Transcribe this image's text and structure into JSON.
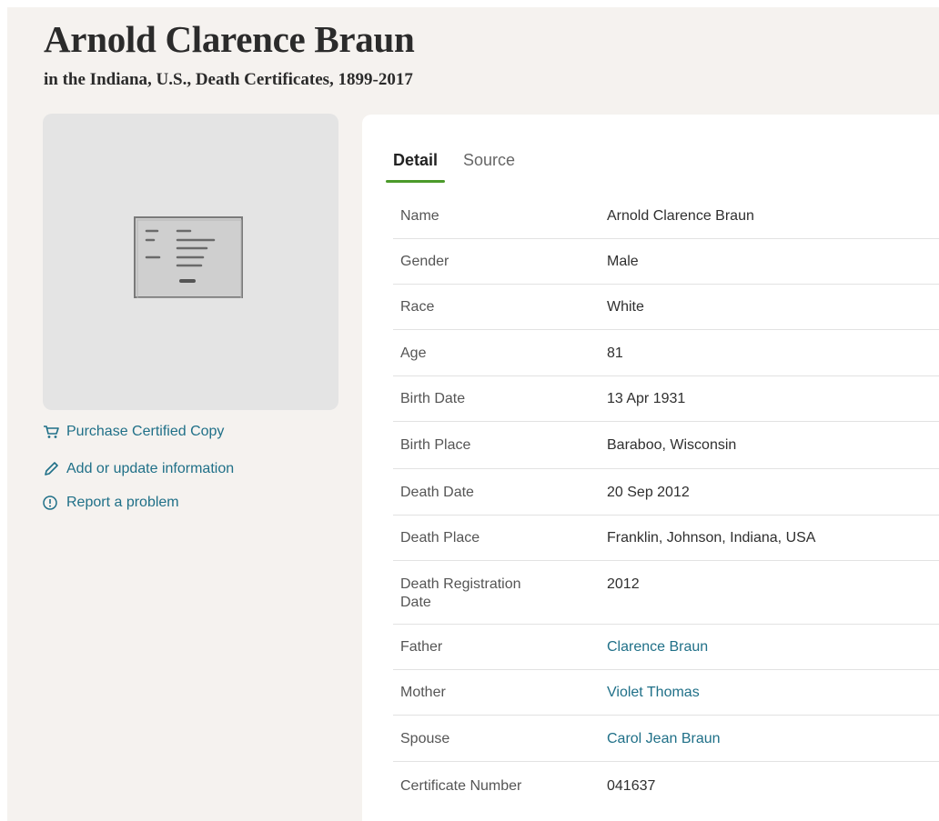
{
  "record": {
    "title": "Arnold Clarence Braun",
    "collection": "in the Indiana, U.S., Death Certificates, 1899-2017"
  },
  "thumbnail": {
    "icon": "document-placeholder-icon"
  },
  "actions": [
    {
      "label": "Purchase Certified Copy",
      "icon": "cart-icon"
    },
    {
      "label": "Add or update information",
      "icon": "pencil-icon"
    },
    {
      "label": "Report a problem",
      "icon": "alert-circle-icon"
    }
  ],
  "tabs": [
    {
      "label": "Detail",
      "active": true
    },
    {
      "label": "Source",
      "active": false
    }
  ],
  "details": [
    {
      "label": "Name",
      "value": "Arnold Clarence Braun",
      "link": false
    },
    {
      "label": "Gender",
      "value": "Male",
      "link": false
    },
    {
      "label": "Race",
      "value": "White",
      "link": false
    },
    {
      "label": "Age",
      "value": "81",
      "link": false
    },
    {
      "label": "Birth Date",
      "value": "13 Apr 1931",
      "link": false
    },
    {
      "label": "Birth Place",
      "value": "Baraboo, Wisconsin",
      "link": false
    },
    {
      "label": "Death Date",
      "value": "20 Sep 2012",
      "link": false
    },
    {
      "label": "Death Place",
      "value": "Franklin, Johnson, Indiana, USA",
      "link": false
    },
    {
      "label": "Death Registration Date",
      "value": "2012",
      "link": false
    },
    {
      "label": "Father",
      "value": "Clarence Braun",
      "link": true
    },
    {
      "label": "Mother",
      "value": "Violet Thomas",
      "link": true
    },
    {
      "label": "Spouse",
      "value": "Carol Jean Braun",
      "link": true
    },
    {
      "label": "Certificate Number",
      "value": "041637",
      "link": false
    }
  ],
  "colors": {
    "link": "#207088",
    "tab_underline": "#4b9a2a",
    "page_background": "#f5f2ef"
  }
}
